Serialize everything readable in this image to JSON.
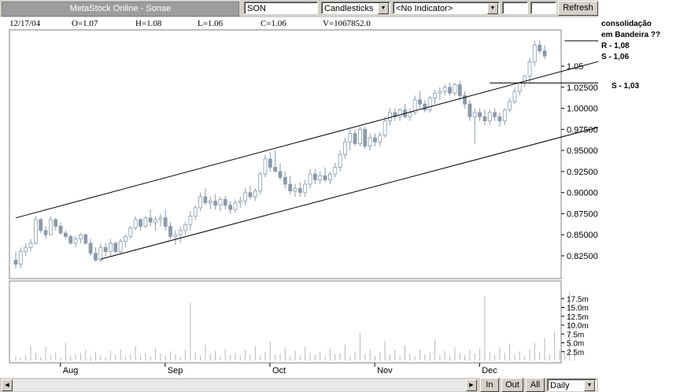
{
  "toolbar": {
    "title": "MetaStock Online - Sonae",
    "symbol": "SON",
    "chart_type": "Candlesticks",
    "indicator": "<No Indicator>",
    "refresh_label": "Refresh"
  },
  "quote": {
    "date": "12/17/04",
    "open": "O=1.07",
    "high": "H=1.08",
    "low": "L=1.06",
    "close": "C=1.06",
    "volume": "V=1067852.0"
  },
  "annotations": {
    "line1": "consolidação",
    "line2": "em Bandeira ??",
    "line3": "R - 1,08",
    "line4": "S - 1,06",
    "line5": "S - 1,03"
  },
  "bottom": {
    "zoom_in": "In",
    "zoom_out": "Out",
    "all": "All",
    "period": "Daily"
  },
  "colors": {
    "up_candle": "#ffffff",
    "down_candle": "#8b9aab",
    "wick": "#8b9aab",
    "volume": "#b0b8c4",
    "trendline": "#000000"
  },
  "chart_data": {
    "type": "candlestick",
    "price_axis_ticks": [
      "1.05",
      "1.02500",
      "1.00000",
      "0.97500",
      "0.95000",
      "0.92500",
      "0.90000",
      "0.87500",
      "0.85000",
      "0.82500"
    ],
    "volume_axis_ticks": [
      "17.5m",
      "15.0m",
      "12.5m",
      "10.0m",
      "7.5m",
      "5.0m",
      "2.5m"
    ],
    "x_month_labels": [
      "Aug",
      "Sep",
      "Oct",
      "Nov",
      "Dec"
    ],
    "price_ylim": [
      0.8,
      1.085
    ],
    "volume_ylim": [
      0,
      20
    ],
    "trendlines": [
      {
        "name": "upper channel",
        "from": [
          0,
          0.87
        ],
        "to": [
          119,
          1.064
        ]
      },
      {
        "name": "lower channel",
        "from": [
          17,
          0.821
        ],
        "to": [
          119,
          0.986
        ]
      },
      {
        "name": "resistance",
        "from": [
          110,
          1.08
        ],
        "to": [
          119,
          1.08
        ]
      },
      {
        "name": "support",
        "from": [
          95,
          1.03
        ],
        "to": [
          119,
          1.03
        ]
      }
    ],
    "candles_ohlc": [
      [
        0.82,
        0.83,
        0.81,
        0.815
      ],
      [
        0.815,
        0.835,
        0.81,
        0.83
      ],
      [
        0.83,
        0.84,
        0.825,
        0.835
      ],
      [
        0.835,
        0.845,
        0.83,
        0.84
      ],
      [
        0.84,
        0.872,
        0.838,
        0.868
      ],
      [
        0.868,
        0.87,
        0.852,
        0.855
      ],
      [
        0.855,
        0.86,
        0.845,
        0.85
      ],
      [
        0.85,
        0.872,
        0.85,
        0.868
      ],
      [
        0.868,
        0.87,
        0.855,
        0.86
      ],
      [
        0.86,
        0.865,
        0.85,
        0.852
      ],
      [
        0.852,
        0.855,
        0.845,
        0.848
      ],
      [
        0.848,
        0.85,
        0.838,
        0.84
      ],
      [
        0.84,
        0.848,
        0.835,
        0.845
      ],
      [
        0.845,
        0.852,
        0.84,
        0.85
      ],
      [
        0.85,
        0.852,
        0.838,
        0.84
      ],
      [
        0.84,
        0.845,
        0.825,
        0.828
      ],
      [
        0.828,
        0.835,
        0.818,
        0.82
      ],
      [
        0.82,
        0.84,
        0.818,
        0.835
      ],
      [
        0.835,
        0.84,
        0.825,
        0.83
      ],
      [
        0.83,
        0.845,
        0.825,
        0.84
      ],
      [
        0.84,
        0.842,
        0.828,
        0.83
      ],
      [
        0.83,
        0.845,
        0.828,
        0.842
      ],
      [
        0.842,
        0.85,
        0.835,
        0.848
      ],
      [
        0.848,
        0.86,
        0.845,
        0.858
      ],
      [
        0.858,
        0.872,
        0.855,
        0.868
      ],
      [
        0.868,
        0.87,
        0.855,
        0.86
      ],
      [
        0.86,
        0.872,
        0.858,
        0.87
      ],
      [
        0.87,
        0.88,
        0.86,
        0.865
      ],
      [
        0.865,
        0.872,
        0.855,
        0.868
      ],
      [
        0.868,
        0.875,
        0.86,
        0.87
      ],
      [
        0.87,
        0.88,
        0.855,
        0.86
      ],
      [
        0.86,
        0.865,
        0.845,
        0.848
      ],
      [
        0.848,
        0.855,
        0.838,
        0.85
      ],
      [
        0.85,
        0.86,
        0.84,
        0.855
      ],
      [
        0.855,
        0.865,
        0.85,
        0.862
      ],
      [
        0.862,
        0.878,
        0.855,
        0.872
      ],
      [
        0.872,
        0.885,
        0.868,
        0.882
      ],
      [
        0.882,
        0.9,
        0.878,
        0.895
      ],
      [
        0.895,
        0.905,
        0.885,
        0.888
      ],
      [
        0.888,
        0.895,
        0.88,
        0.89
      ],
      [
        0.89,
        0.898,
        0.88,
        0.885
      ],
      [
        0.885,
        0.895,
        0.878,
        0.892
      ],
      [
        0.892,
        0.896,
        0.88,
        0.885
      ],
      [
        0.885,
        0.89,
        0.875,
        0.88
      ],
      [
        0.88,
        0.892,
        0.876,
        0.888
      ],
      [
        0.888,
        0.895,
        0.882,
        0.89
      ],
      [
        0.89,
        0.905,
        0.885,
        0.9
      ],
      [
        0.9,
        0.908,
        0.892,
        0.895
      ],
      [
        0.895,
        0.905,
        0.89,
        0.902
      ],
      [
        0.902,
        0.925,
        0.898,
        0.922
      ],
      [
        0.922,
        0.945,
        0.918,
        0.94
      ],
      [
        0.94,
        0.948,
        0.925,
        0.93
      ],
      [
        0.93,
        0.95,
        0.925,
        0.925
      ],
      [
        0.925,
        0.935,
        0.915,
        0.918
      ],
      [
        0.918,
        0.925,
        0.905,
        0.91
      ],
      [
        0.91,
        0.92,
        0.898,
        0.902
      ],
      [
        0.902,
        0.91,
        0.895,
        0.905
      ],
      [
        0.905,
        0.912,
        0.895,
        0.9
      ],
      [
        0.9,
        0.915,
        0.895,
        0.91
      ],
      [
        0.91,
        0.928,
        0.905,
        0.922
      ],
      [
        0.922,
        0.928,
        0.91,
        0.915
      ],
      [
        0.915,
        0.925,
        0.91,
        0.92
      ],
      [
        0.92,
        0.93,
        0.912,
        0.915
      ],
      [
        0.915,
        0.925,
        0.91,
        0.922
      ],
      [
        0.922,
        0.935,
        0.918,
        0.93
      ],
      [
        0.93,
        0.95,
        0.925,
        0.945
      ],
      [
        0.945,
        0.965,
        0.94,
        0.96
      ],
      [
        0.96,
        0.975,
        0.95,
        0.97
      ],
      [
        0.97,
        0.975,
        0.955,
        0.958
      ],
      [
        0.958,
        0.978,
        0.955,
        0.975
      ],
      [
        0.975,
        0.978,
        0.952,
        0.955
      ],
      [
        0.955,
        0.97,
        0.95,
        0.965
      ],
      [
        0.965,
        0.97,
        0.955,
        0.96
      ],
      [
        0.96,
        0.972,
        0.955,
        0.968
      ],
      [
        0.968,
        0.99,
        0.965,
        0.985
      ],
      [
        0.985,
        1.0,
        0.98,
        0.995
      ],
      [
        0.995,
        1.0,
        0.985,
        0.99
      ],
      [
        0.99,
        1.0,
        0.985,
        0.998
      ],
      [
        0.998,
        1.005,
        0.988,
        0.99
      ],
      [
        0.99,
        1.0,
        0.985,
        0.995
      ],
      [
        0.995,
        1.015,
        0.992,
        1.01
      ],
      [
        1.01,
        1.02,
        1.0,
        1.005
      ],
      [
        1.005,
        1.01,
        0.995,
        0.998
      ],
      [
        0.998,
        1.015,
        0.995,
        1.012
      ],
      [
        1.012,
        1.022,
        1.005,
        1.018
      ],
      [
        1.018,
        1.025,
        1.01,
        1.02
      ],
      [
        1.02,
        1.028,
        1.015,
        1.025
      ],
      [
        1.025,
        1.03,
        1.015,
        1.018
      ],
      [
        1.018,
        1.03,
        1.015,
        1.028
      ],
      [
        1.028,
        1.032,
        1.01,
        1.015
      ],
      [
        1.015,
        1.02,
        1.0,
        1.005
      ],
      [
        1.005,
        1.01,
        0.985,
        0.99
      ],
      [
        0.99,
        1.0,
        0.958,
        0.995
      ],
      [
        0.995,
        1.0,
        0.985,
        0.99
      ],
      [
        0.99,
        0.998,
        0.98,
        0.985
      ],
      [
        0.985,
        0.998,
        0.98,
        0.995
      ],
      [
        0.995,
        1.0,
        0.985,
        0.99
      ],
      [
        0.99,
        0.995,
        0.978,
        0.985
      ],
      [
        0.985,
        1.0,
        0.98,
        0.998
      ],
      [
        0.998,
        1.012,
        0.995,
        1.008
      ],
      [
        1.008,
        1.025,
        1.005,
        1.02
      ],
      [
        1.02,
        1.03,
        1.015,
        1.03
      ],
      [
        1.03,
        1.04,
        1.025,
        1.038
      ],
      [
        1.038,
        1.06,
        1.03,
        1.055
      ],
      [
        1.055,
        1.08,
        1.05,
        1.075
      ],
      [
        1.075,
        1.08,
        1.065,
        1.068
      ],
      [
        1.068,
        1.075,
        1.058,
        1.062
      ]
    ],
    "volume_m": [
      1.2,
      0.8,
      1.5,
      4.2,
      2.1,
      1.0,
      3.8,
      1.6,
      2.4,
      0.9,
      5.1,
      1.3,
      1.8,
      2.2,
      3.0,
      1.1,
      2.5,
      1.4,
      0.9,
      2.8,
      1.7,
      3.2,
      1.2,
      1.9,
      4.0,
      1.5,
      2.3,
      1.1,
      3.5,
      2.0,
      1.3,
      2.6,
      1.8,
      1.0,
      3.1,
      16.5,
      2.2,
      1.5,
      4.4,
      1.9,
      2.7,
      1.2,
      3.3,
      1.6,
      2.1,
      1.4,
      2.9,
      1.8,
      4.1,
      1.3,
      2.4,
      5.3,
      1.7,
      2.0,
      3.6,
      1.1,
      2.8,
      1.5,
      3.9,
      2.2,
      1.6,
      2.5,
      1.3,
      3.4,
      1.9,
      2.1,
      4.5,
      1.4,
      2.6,
      7.8,
      1.8,
      3.0,
      1.2,
      2.3,
      5.6,
      1.7,
      2.9,
      1.5,
      4.2,
      2.0,
      1.3,
      3.1,
      1.8,
      2.4,
      6.1,
      1.6,
      2.7,
      1.4,
      3.8,
      2.1,
      1.5,
      2.9,
      1.9,
      3.3,
      18.0,
      2.5,
      1.6,
      3.7,
      2.2,
      4.8,
      1.8,
      2.6,
      1.4,
      3.2,
      5.0,
      2.3,
      6.4,
      1.7,
      8.2,
      2.8,
      3.0,
      19.5,
      3.4
    ]
  }
}
